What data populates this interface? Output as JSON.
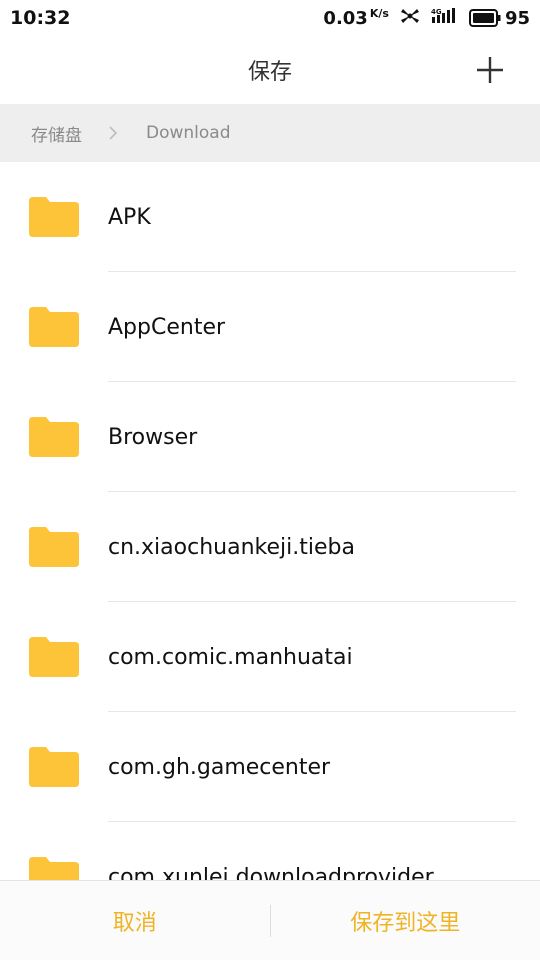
{
  "status_bar": {
    "time": "10:32",
    "net_speed": "0.03",
    "net_speed_unit": "K/s",
    "battery_level": "95"
  },
  "header": {
    "title": "保存",
    "add_icon": "plus-icon"
  },
  "breadcrumb": {
    "items": [
      "存储盘",
      "Download"
    ],
    "separator_icon": "chevron-right-icon"
  },
  "folders": [
    {
      "name": "APK"
    },
    {
      "name": "AppCenter"
    },
    {
      "name": "Browser"
    },
    {
      "name": "cn.xiaochuankeji.tieba"
    },
    {
      "name": "com.comic.manhuatai"
    },
    {
      "name": "com.gh.gamecenter"
    },
    {
      "name": "com.xunlei.downloadprovider"
    }
  ],
  "bottom_bar": {
    "cancel_label": "取消",
    "save_here_label": "保存到这里"
  },
  "colors": {
    "folder": "#fec439",
    "accent": "#f0b323"
  }
}
